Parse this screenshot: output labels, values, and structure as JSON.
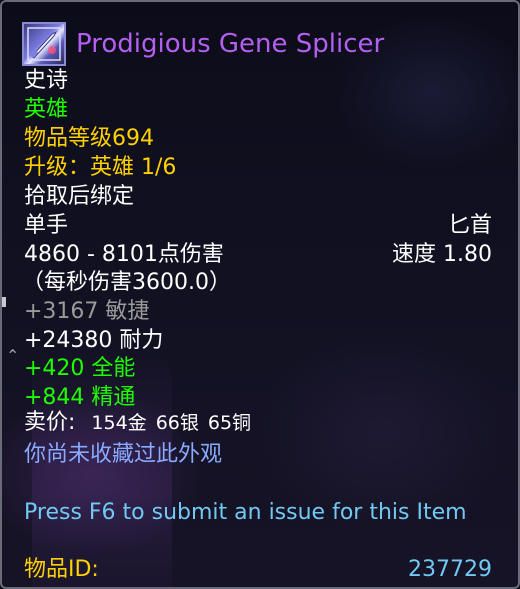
{
  "item": {
    "icon": "dagger-item-icon",
    "name": "Prodigious Gene Splicer",
    "quality": "史诗",
    "tier": "英雄",
    "item_level": "物品等级694",
    "upgrade": "升级：英雄 1/6",
    "binding": "拾取后绑定",
    "slot": "单手",
    "weapon_type": "匕首",
    "damage": "4860 - 8101点伤害",
    "speed": "速度 1.80",
    "dps": "（每秒伤害3600.0）",
    "stats": {
      "agility": "+3167 敏捷",
      "stamina": "+24380 耐力",
      "versatility": "+420 全能",
      "mastery": "+844 精通"
    },
    "sell_price": {
      "label": "卖价:",
      "gold": "154金",
      "silver": "66银",
      "copper": "65铜"
    },
    "appearance_note": "你尚未收藏过此外观",
    "report_hint": "Press F6 to submit an issue for this Item",
    "id_label": "物品ID:",
    "id_value": "237729"
  },
  "colors": {
    "name_epic": "#b35ff0",
    "green_text": "#1eff00",
    "yellow_text": "#ffd100",
    "inactive_stat": "#9a9a9a",
    "appearance_blue": "#88aaff",
    "hint_cyan": "#71c9f3"
  }
}
